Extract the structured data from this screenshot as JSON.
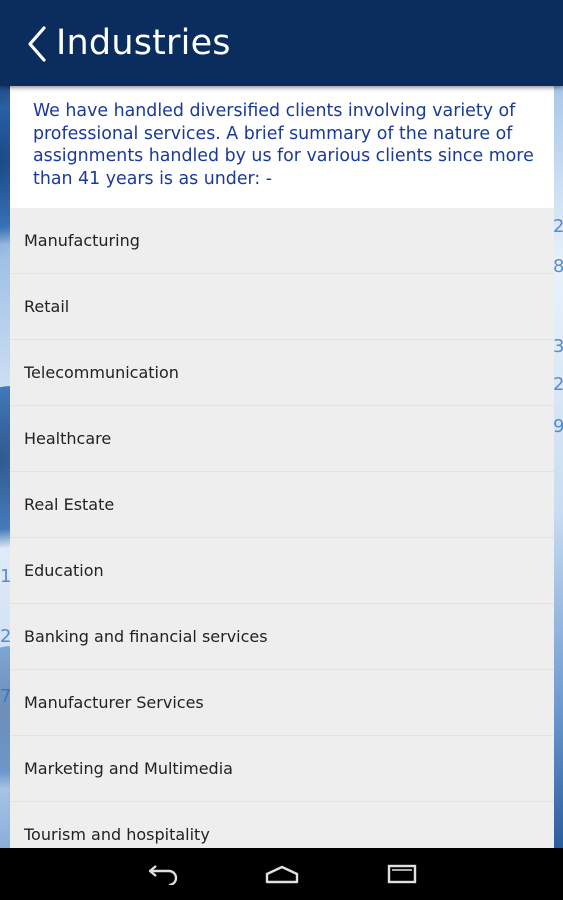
{
  "header": {
    "title": "Industries",
    "back_icon": "chevron-left-icon"
  },
  "intro": {
    "text": "We have handled diversified clients involving variety of professional services. A brief summary of the nature of assignments handled by us for various clients since more than 41 years is as under: -"
  },
  "industries": [
    {
      "label": "Manufacturing"
    },
    {
      "label": "Retail"
    },
    {
      "label": "Telecommunication"
    },
    {
      "label": "Healthcare"
    },
    {
      "label": "Real Estate"
    },
    {
      "label": "Education"
    },
    {
      "label": "Banking and financial services"
    },
    {
      "label": "Manufacturer Services"
    },
    {
      "label": "Marketing and Multimedia"
    },
    {
      "label": "Tourism and hospitality"
    }
  ],
  "navbar": {
    "buttons": [
      "back-nav-icon",
      "home-nav-icon",
      "recents-nav-icon"
    ]
  },
  "colors": {
    "appbar": "#0b2d5e",
    "intro_text": "#1a3a9a",
    "list_bg": "#eeeeee"
  }
}
